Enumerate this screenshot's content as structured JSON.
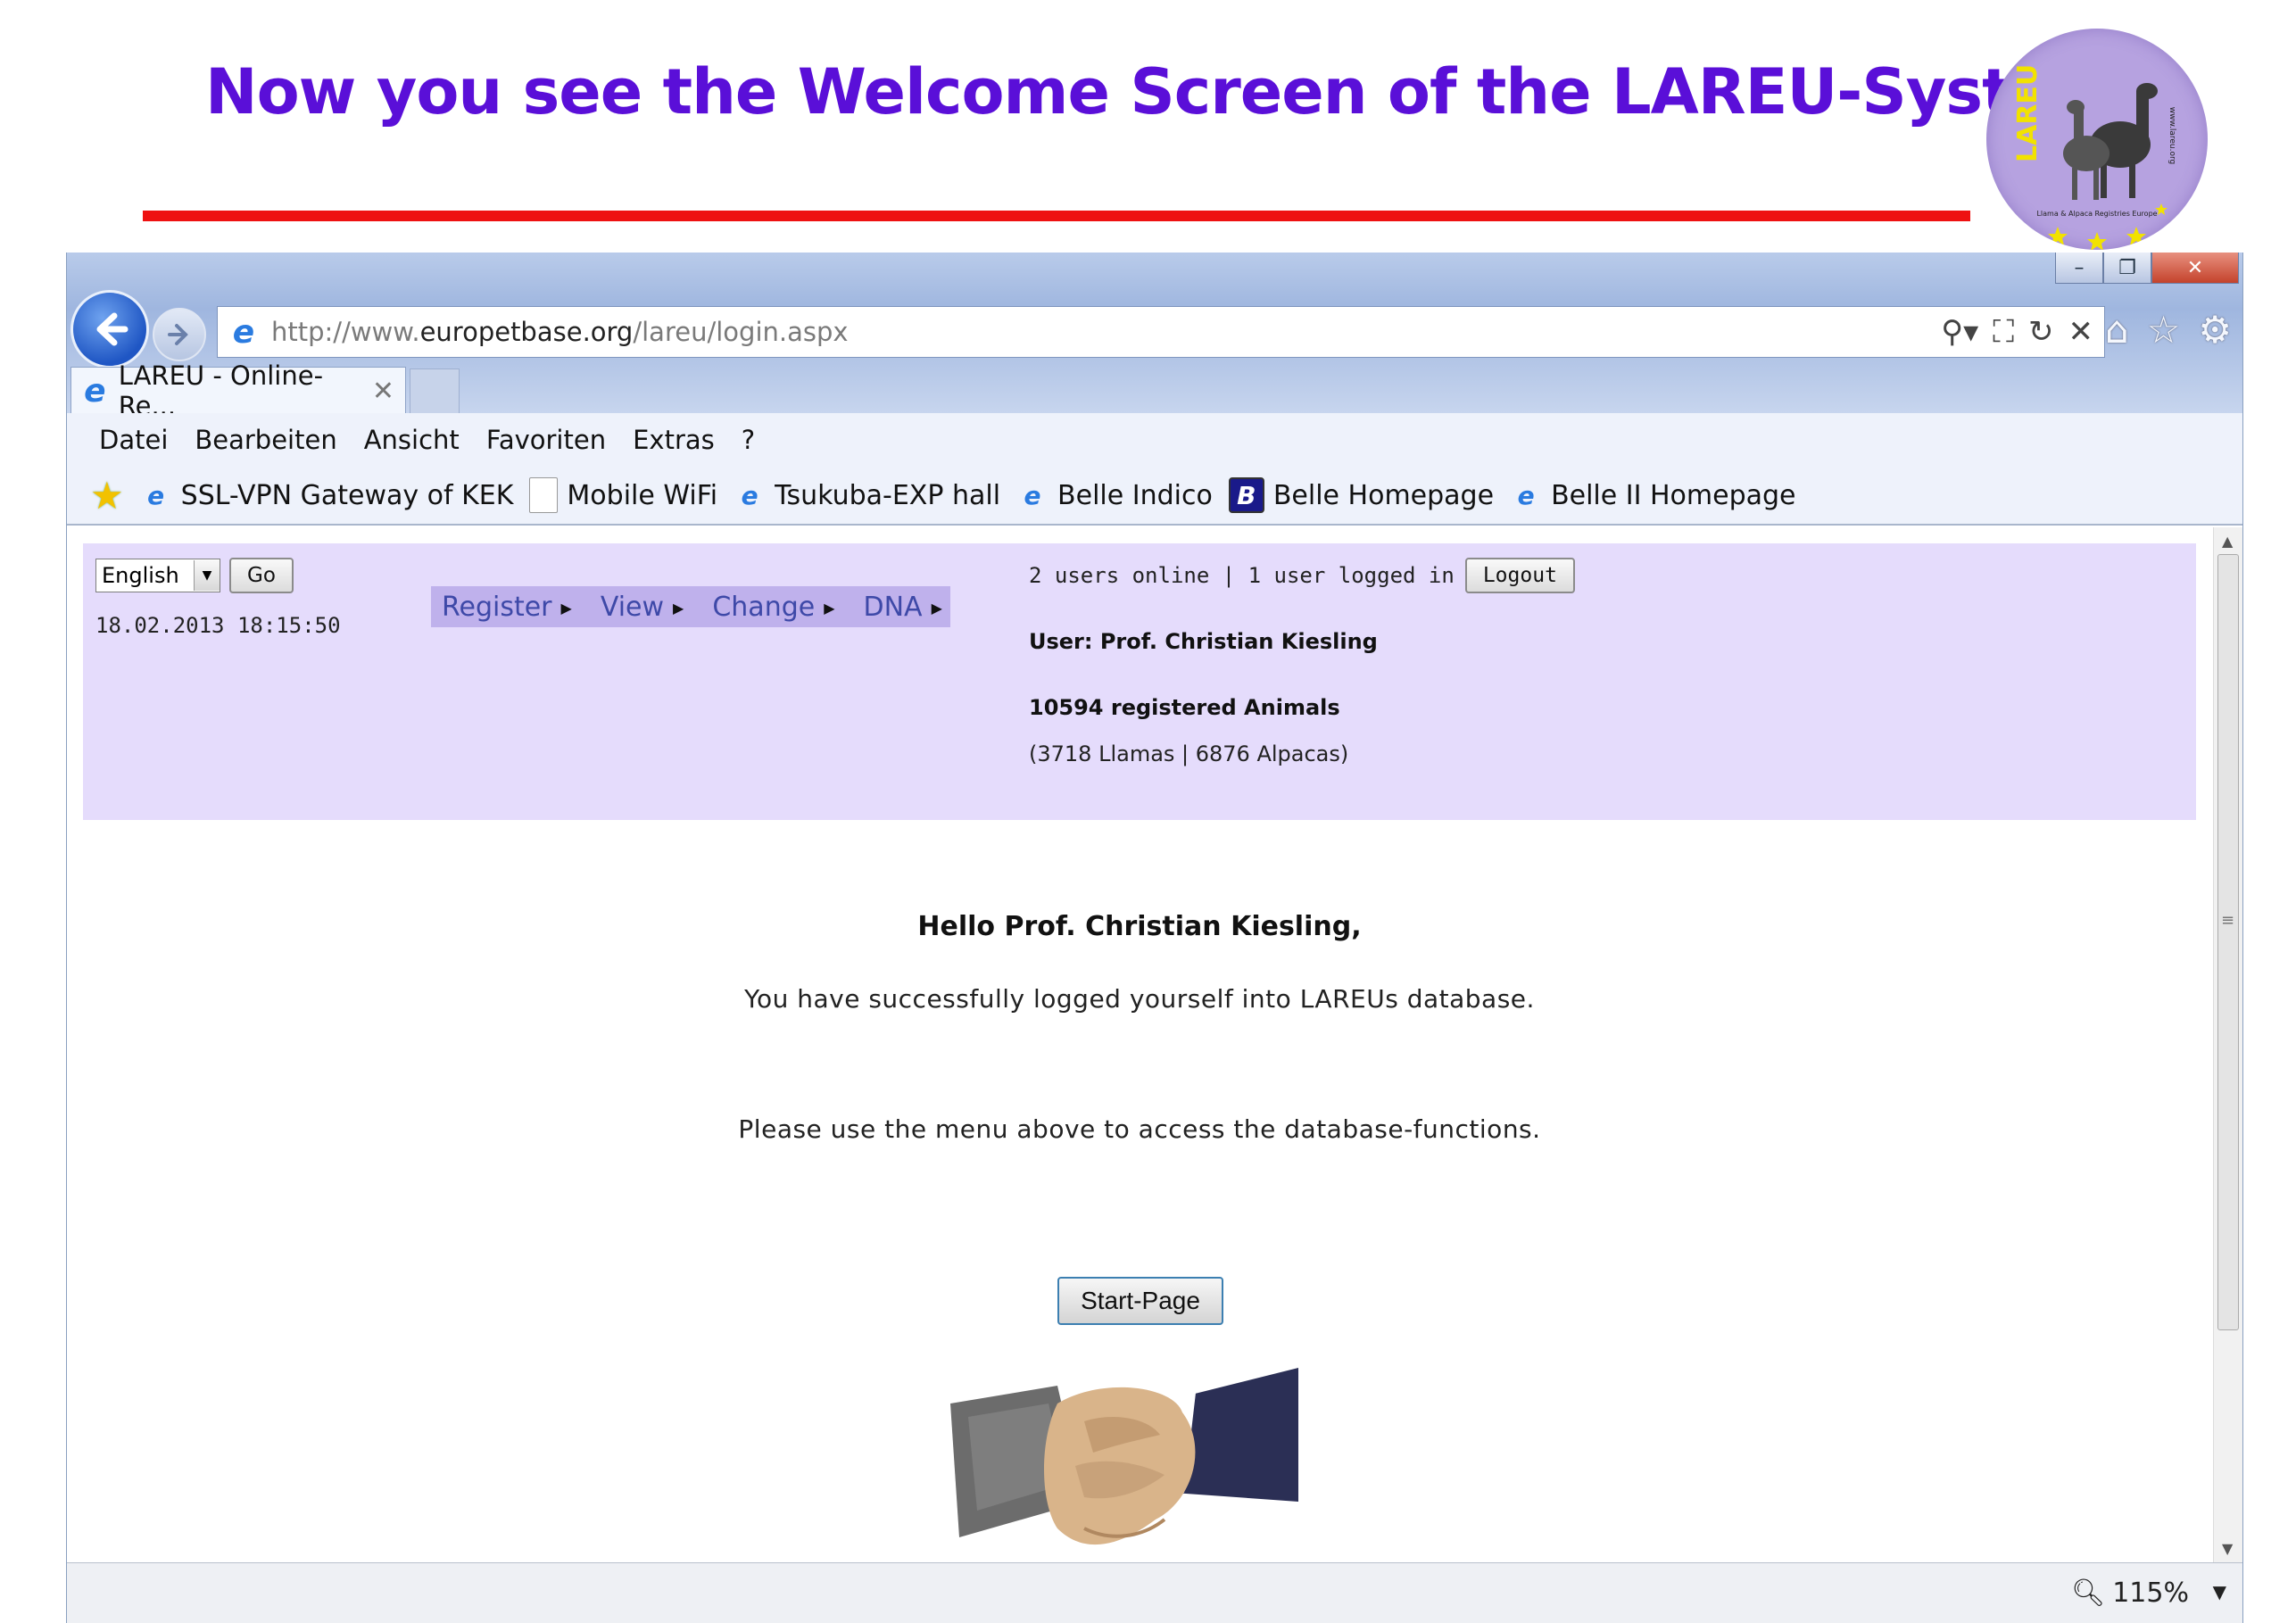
{
  "slide": {
    "title": "Now you see the Welcome Screen of the LAREU-System",
    "logo": {
      "text": "LAREU",
      "subtitle": "Llama & Alpaca Registries Europe",
      "site": "www.lareu.org"
    },
    "colors": {
      "title": "#5a0fd8",
      "rule": "#ee1111",
      "logo_bg": "#b6a2e0"
    }
  },
  "browser": {
    "window_controls": {
      "minimize": "–",
      "restore": "❐",
      "close": "✕"
    },
    "back_icon": "back-arrow-icon",
    "forward_icon": "forward-arrow-icon",
    "url_prefix": "http://www.",
    "url_domain": "europetbase.org",
    "url_path": "/lareu/login.aspx",
    "address_icons": {
      "search": "⚲▾",
      "compat": "⛶",
      "refresh": "↻",
      "stop": "✕"
    },
    "tool_icons": {
      "home": "⌂",
      "favorites": "☆",
      "settings": "⚙"
    },
    "tab": {
      "label": "LAREU - Online-Re...",
      "close": "✕"
    },
    "menu": [
      "Datei",
      "Bearbeiten",
      "Ansicht",
      "Favoriten",
      "Extras",
      "?"
    ],
    "favorites": [
      {
        "label": "SSL-VPN Gateway of KEK",
        "icon": "ie-icon"
      },
      {
        "label": "Mobile WiFi",
        "icon": "page-icon"
      },
      {
        "label": "Tsukuba-EXP hall",
        "icon": "ie-icon"
      },
      {
        "label": "Belle Indico",
        "icon": "ie-icon"
      },
      {
        "label": "Belle Homepage",
        "icon": "belle-icon"
      },
      {
        "label": "Belle II Homepage",
        "icon": "ie-icon"
      }
    ],
    "zoom": "115%"
  },
  "page": {
    "language": "English",
    "go_label": "Go",
    "datetime": "18.02.2013 18:15:50",
    "nav": [
      "Register",
      "View",
      "Change",
      "DNA"
    ],
    "online_status": "2 users online | 1 user logged in",
    "logout_label": "Logout",
    "user": "User: Prof. Christian Kiesling",
    "registered": "10594 registered Animals",
    "breakdown": "(3718 Llamas | 6876 Alpacas)",
    "hello": "Hello Prof. Christian Kiesling,",
    "success": "You have successfully logged yourself into LAREUs database.",
    "instruction": "Please use the menu above to access the database-functions.",
    "start_label": "Start-Page",
    "colors": {
      "panel": "#e5dcfc",
      "nav_bg": "#bfb1ec",
      "nav_text": "#3e49a8"
    }
  }
}
